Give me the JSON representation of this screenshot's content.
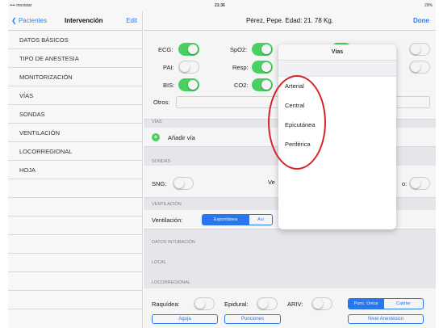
{
  "status_bar": {
    "carrier": "•••• movistar",
    "time": "21:36",
    "battery": "29%"
  },
  "master": {
    "back_label": "Pacientes",
    "title": "Intervención",
    "edit_label": "Edit",
    "items": [
      {
        "label": "DATOS BÁSICOS"
      },
      {
        "label": "TIPO DE ANESTESIA"
      },
      {
        "label": "MONITORIZACIÓN"
      },
      {
        "label": "VÍAS"
      },
      {
        "label": "SONDAS"
      },
      {
        "label": "VENTILACIÓN"
      },
      {
        "label": "LOCORREGIONAL"
      },
      {
        "label": "HOJA"
      }
    ]
  },
  "detail": {
    "title": "Pérez, Pepe. Edad: 21. 78 Kg.",
    "done_label": "Done",
    "monitor": {
      "ecg_label": "ECG:",
      "ecg_on": true,
      "spo2_label": "SpO2:",
      "spo2_on": true,
      "pai_label": "PAI:",
      "pai_on": false,
      "resp_label": "Resp:",
      "resp_on": true,
      "bis_label": "BIS:",
      "bis_on": true,
      "co2_label": "CO2:",
      "co2_on": true,
      "otros_label": "Otros:",
      "otros_value": ""
    },
    "vias": {
      "header": "VÍAS",
      "add_label": "Añadir vía"
    },
    "sondas": {
      "header": "SONDAS",
      "sng_label": "SNG:",
      "sng_on": false,
      "ve_partial": "Ve",
      "third_partial": "o:",
      "third_on": false
    },
    "ventilacion": {
      "header": "VENTILACIÓN",
      "label": "Ventilación:",
      "options": [
        "Espontánea",
        "Asi"
      ],
      "selected": 0
    },
    "datos_intubacion": {
      "header": "DATOS INTUBACIÓN"
    },
    "local": {
      "header": "LOCAL"
    },
    "locorregional": {
      "header": "LOCORREGIONAL",
      "raquidea_label": "Raquídea:",
      "raquidea_on": false,
      "epidural_label": "Epidural:",
      "epidural_on": false,
      "ariv_label": "ARIV:",
      "ariv_on": false,
      "punc_options": [
        "Punc. Única",
        "Catéter"
      ],
      "punc_selected": 0,
      "aguja_label": "Aguja",
      "punciones_label": "Punciones",
      "nivel_label": "Nivel Anestésico"
    }
  },
  "popover": {
    "title": "Vías",
    "options": [
      {
        "label": "Arterial"
      },
      {
        "label": "Central"
      },
      {
        "label": "Epicutánea"
      },
      {
        "label": "Periférica"
      }
    ]
  },
  "colors": {
    "accent": "#2a7cf6",
    "switch_on": "#4cd964",
    "annotation_red": "#d6202a"
  }
}
